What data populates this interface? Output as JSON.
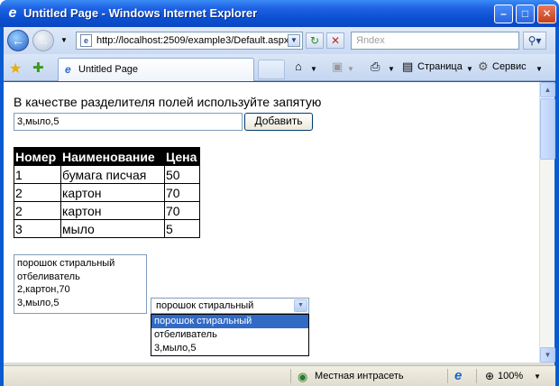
{
  "window": {
    "title": "Untitled Page - Windows Internet Explorer"
  },
  "address_bar": {
    "url": "http://localhost:2509/example3/Default.aspx",
    "search_placeholder": "Яndex"
  },
  "tab": {
    "label": "Untitled Page"
  },
  "commands": {
    "page_label": "Страница",
    "service_label": "Сервис"
  },
  "page": {
    "instruction": "В качестве разделителя полей используйте запятую",
    "input_value": "3,мыло,5",
    "add_button_label": "Добавить",
    "table": {
      "headers": [
        "Номер",
        "Наименование",
        "Цена"
      ],
      "rows": [
        [
          "1",
          "бумага писчая",
          "50"
        ],
        [
          "2",
          "картон",
          "70"
        ],
        [
          "2",
          "картон",
          "70"
        ],
        [
          "3",
          "мыло",
          "5"
        ]
      ]
    },
    "listbox_items": [
      "порошок стиральный",
      "отбеливатель",
      "2,картон,70",
      "3,мыло,5"
    ],
    "combo_selected": "порошок стиральный",
    "dropdown_items": [
      "порошок стиральный",
      "отбеливатель",
      "3,мыло,5"
    ]
  },
  "status_bar": {
    "zone": "Местная интрасеть",
    "zoom": "100%"
  }
}
